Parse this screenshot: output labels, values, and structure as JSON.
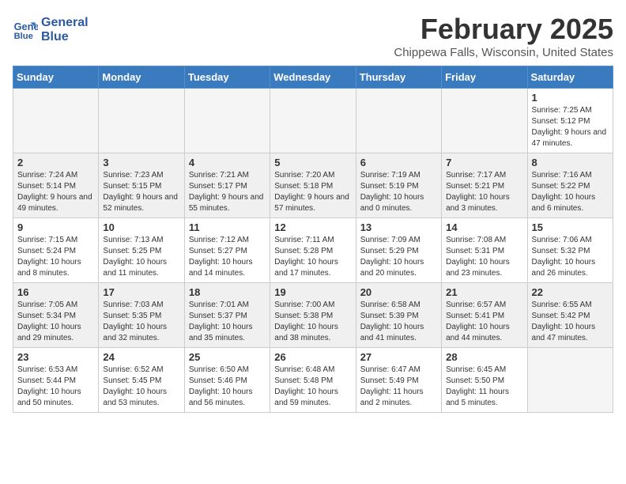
{
  "header": {
    "logo_line1": "General",
    "logo_line2": "Blue",
    "month_title": "February 2025",
    "location": "Chippewa Falls, Wisconsin, United States"
  },
  "weekdays": [
    "Sunday",
    "Monday",
    "Tuesday",
    "Wednesday",
    "Thursday",
    "Friday",
    "Saturday"
  ],
  "weeks": [
    [
      {
        "num": "",
        "info": ""
      },
      {
        "num": "",
        "info": ""
      },
      {
        "num": "",
        "info": ""
      },
      {
        "num": "",
        "info": ""
      },
      {
        "num": "",
        "info": ""
      },
      {
        "num": "",
        "info": ""
      },
      {
        "num": "1",
        "info": "Sunrise: 7:25 AM\nSunset: 5:12 PM\nDaylight: 9 hours and 47 minutes."
      }
    ],
    [
      {
        "num": "2",
        "info": "Sunrise: 7:24 AM\nSunset: 5:14 PM\nDaylight: 9 hours and 49 minutes."
      },
      {
        "num": "3",
        "info": "Sunrise: 7:23 AM\nSunset: 5:15 PM\nDaylight: 9 hours and 52 minutes."
      },
      {
        "num": "4",
        "info": "Sunrise: 7:21 AM\nSunset: 5:17 PM\nDaylight: 9 hours and 55 minutes."
      },
      {
        "num": "5",
        "info": "Sunrise: 7:20 AM\nSunset: 5:18 PM\nDaylight: 9 hours and 57 minutes."
      },
      {
        "num": "6",
        "info": "Sunrise: 7:19 AM\nSunset: 5:19 PM\nDaylight: 10 hours and 0 minutes."
      },
      {
        "num": "7",
        "info": "Sunrise: 7:17 AM\nSunset: 5:21 PM\nDaylight: 10 hours and 3 minutes."
      },
      {
        "num": "8",
        "info": "Sunrise: 7:16 AM\nSunset: 5:22 PM\nDaylight: 10 hours and 6 minutes."
      }
    ],
    [
      {
        "num": "9",
        "info": "Sunrise: 7:15 AM\nSunset: 5:24 PM\nDaylight: 10 hours and 8 minutes."
      },
      {
        "num": "10",
        "info": "Sunrise: 7:13 AM\nSunset: 5:25 PM\nDaylight: 10 hours and 11 minutes."
      },
      {
        "num": "11",
        "info": "Sunrise: 7:12 AM\nSunset: 5:27 PM\nDaylight: 10 hours and 14 minutes."
      },
      {
        "num": "12",
        "info": "Sunrise: 7:11 AM\nSunset: 5:28 PM\nDaylight: 10 hours and 17 minutes."
      },
      {
        "num": "13",
        "info": "Sunrise: 7:09 AM\nSunset: 5:29 PM\nDaylight: 10 hours and 20 minutes."
      },
      {
        "num": "14",
        "info": "Sunrise: 7:08 AM\nSunset: 5:31 PM\nDaylight: 10 hours and 23 minutes."
      },
      {
        "num": "15",
        "info": "Sunrise: 7:06 AM\nSunset: 5:32 PM\nDaylight: 10 hours and 26 minutes."
      }
    ],
    [
      {
        "num": "16",
        "info": "Sunrise: 7:05 AM\nSunset: 5:34 PM\nDaylight: 10 hours and 29 minutes."
      },
      {
        "num": "17",
        "info": "Sunrise: 7:03 AM\nSunset: 5:35 PM\nDaylight: 10 hours and 32 minutes."
      },
      {
        "num": "18",
        "info": "Sunrise: 7:01 AM\nSunset: 5:37 PM\nDaylight: 10 hours and 35 minutes."
      },
      {
        "num": "19",
        "info": "Sunrise: 7:00 AM\nSunset: 5:38 PM\nDaylight: 10 hours and 38 minutes."
      },
      {
        "num": "20",
        "info": "Sunrise: 6:58 AM\nSunset: 5:39 PM\nDaylight: 10 hours and 41 minutes."
      },
      {
        "num": "21",
        "info": "Sunrise: 6:57 AM\nSunset: 5:41 PM\nDaylight: 10 hours and 44 minutes."
      },
      {
        "num": "22",
        "info": "Sunrise: 6:55 AM\nSunset: 5:42 PM\nDaylight: 10 hours and 47 minutes."
      }
    ],
    [
      {
        "num": "23",
        "info": "Sunrise: 6:53 AM\nSunset: 5:44 PM\nDaylight: 10 hours and 50 minutes."
      },
      {
        "num": "24",
        "info": "Sunrise: 6:52 AM\nSunset: 5:45 PM\nDaylight: 10 hours and 53 minutes."
      },
      {
        "num": "25",
        "info": "Sunrise: 6:50 AM\nSunset: 5:46 PM\nDaylight: 10 hours and 56 minutes."
      },
      {
        "num": "26",
        "info": "Sunrise: 6:48 AM\nSunset: 5:48 PM\nDaylight: 10 hours and 59 minutes."
      },
      {
        "num": "27",
        "info": "Sunrise: 6:47 AM\nSunset: 5:49 PM\nDaylight: 11 hours and 2 minutes."
      },
      {
        "num": "28",
        "info": "Sunrise: 6:45 AM\nSunset: 5:50 PM\nDaylight: 11 hours and 5 minutes."
      },
      {
        "num": "",
        "info": ""
      }
    ]
  ]
}
